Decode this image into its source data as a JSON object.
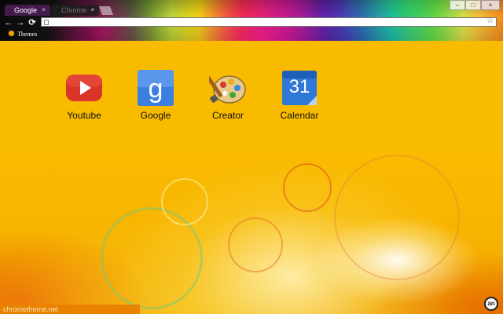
{
  "tabs": [
    {
      "label": "Google",
      "active": true
    },
    {
      "label": "Chrome",
      "active": false
    }
  ],
  "tab_close_glyph": "×",
  "window_controls": {
    "minimize": "–",
    "maximize": "□",
    "close": "×"
  },
  "toolbar": {
    "back_icon": "back-arrow-icon",
    "forward_icon": "forward-arrow-icon",
    "reload_icon": "reload-icon"
  },
  "omnibox": {
    "value": "",
    "star_icon": "star-icon"
  },
  "bookmarks": [
    {
      "label": "Themes"
    }
  ],
  "apps": [
    {
      "label": "Youtube",
      "icon": "youtube-icon"
    },
    {
      "label": "Google",
      "icon": "google-icon"
    },
    {
      "label": "Creator",
      "icon": "palette-icon"
    },
    {
      "label": "Calendar",
      "icon": "calendar-icon",
      "badge": "31"
    }
  ],
  "status_bar": {
    "text": "chrometheme.net"
  },
  "logo": {
    "text": "an"
  },
  "colors": {
    "page_background": "#f8b800",
    "status_bar": "#e88200",
    "youtube_red": "#d9332a",
    "google_blue": "#3a7fe0",
    "calendar_blue": "#2e78d8"
  }
}
